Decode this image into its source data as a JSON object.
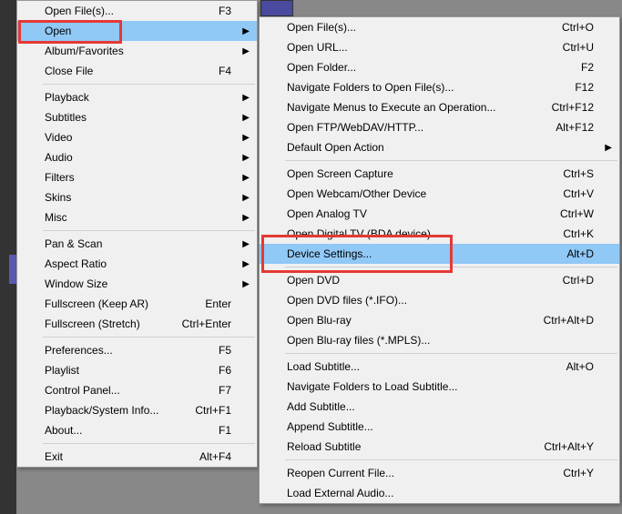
{
  "leftMenu": {
    "groups": [
      [
        {
          "label": "Open File(s)...",
          "shortcut": "F3"
        },
        {
          "label": "Open",
          "shortcut": "",
          "submenu": true,
          "highlighted": true
        },
        {
          "label": "Album/Favorites",
          "shortcut": "",
          "submenu": true
        },
        {
          "label": "Close File",
          "shortcut": "F4"
        }
      ],
      [
        {
          "label": "Playback",
          "shortcut": "",
          "submenu": true
        },
        {
          "label": "Subtitles",
          "shortcut": "",
          "submenu": true
        },
        {
          "label": "Video",
          "shortcut": "",
          "submenu": true
        },
        {
          "label": "Audio",
          "shortcut": "",
          "submenu": true
        },
        {
          "label": "Filters",
          "shortcut": "",
          "submenu": true
        },
        {
          "label": "Skins",
          "shortcut": "",
          "submenu": true
        },
        {
          "label": "Misc",
          "shortcut": "",
          "submenu": true
        }
      ],
      [
        {
          "label": "Pan & Scan",
          "shortcut": "",
          "submenu": true
        },
        {
          "label": "Aspect Ratio",
          "shortcut": "",
          "submenu": true
        },
        {
          "label": "Window Size",
          "shortcut": "",
          "submenu": true
        },
        {
          "label": "Fullscreen (Keep AR)",
          "shortcut": "Enter"
        },
        {
          "label": "Fullscreen (Stretch)",
          "shortcut": "Ctrl+Enter"
        }
      ],
      [
        {
          "label": "Preferences...",
          "shortcut": "F5"
        },
        {
          "label": "Playlist",
          "shortcut": "F6"
        },
        {
          "label": "Control Panel...",
          "shortcut": "F7"
        },
        {
          "label": "Playback/System Info...",
          "shortcut": "Ctrl+F1"
        },
        {
          "label": "About...",
          "shortcut": "F1"
        }
      ],
      [
        {
          "label": "Exit",
          "shortcut": "Alt+F4"
        }
      ]
    ]
  },
  "rightMenu": {
    "groups": [
      [
        {
          "label": "Open File(s)...",
          "shortcut": "Ctrl+O"
        },
        {
          "label": "Open URL...",
          "shortcut": "Ctrl+U"
        },
        {
          "label": "Open Folder...",
          "shortcut": "F2"
        },
        {
          "label": "Navigate Folders to Open File(s)...",
          "shortcut": "F12"
        },
        {
          "label": "Navigate Menus to Execute an Operation...",
          "shortcut": "Ctrl+F12"
        },
        {
          "label": "Open FTP/WebDAV/HTTP...",
          "shortcut": "Alt+F12"
        },
        {
          "label": "Default Open Action",
          "shortcut": "",
          "submenu": true
        }
      ],
      [
        {
          "label": "Open Screen Capture",
          "shortcut": "Ctrl+S"
        },
        {
          "label": "Open Webcam/Other Device",
          "shortcut": "Ctrl+V"
        },
        {
          "label": "Open Analog TV",
          "shortcut": "Ctrl+W"
        },
        {
          "label": "Open Digital TV (BDA device)",
          "shortcut": "Ctrl+K"
        },
        {
          "label": "Device Settings...",
          "shortcut": "Alt+D",
          "highlighted": true
        }
      ],
      [
        {
          "label": "Open DVD",
          "shortcut": "Ctrl+D"
        },
        {
          "label": "Open DVD files (*.IFO)...",
          "shortcut": ""
        },
        {
          "label": "Open Blu-ray",
          "shortcut": "Ctrl+Alt+D"
        },
        {
          "label": "Open Blu-ray files (*.MPLS)...",
          "shortcut": ""
        }
      ],
      [
        {
          "label": "Load Subtitle...",
          "shortcut": "Alt+O"
        },
        {
          "label": "Navigate Folders to Load Subtitle...",
          "shortcut": ""
        },
        {
          "label": "Add Subtitle...",
          "shortcut": ""
        },
        {
          "label": "Append Subtitle...",
          "shortcut": ""
        },
        {
          "label": "Reload Subtitle",
          "shortcut": "Ctrl+Alt+Y"
        }
      ],
      [
        {
          "label": "Reopen Current File...",
          "shortcut": "Ctrl+Y"
        },
        {
          "label": "Load External Audio...",
          "shortcut": ""
        }
      ]
    ]
  }
}
